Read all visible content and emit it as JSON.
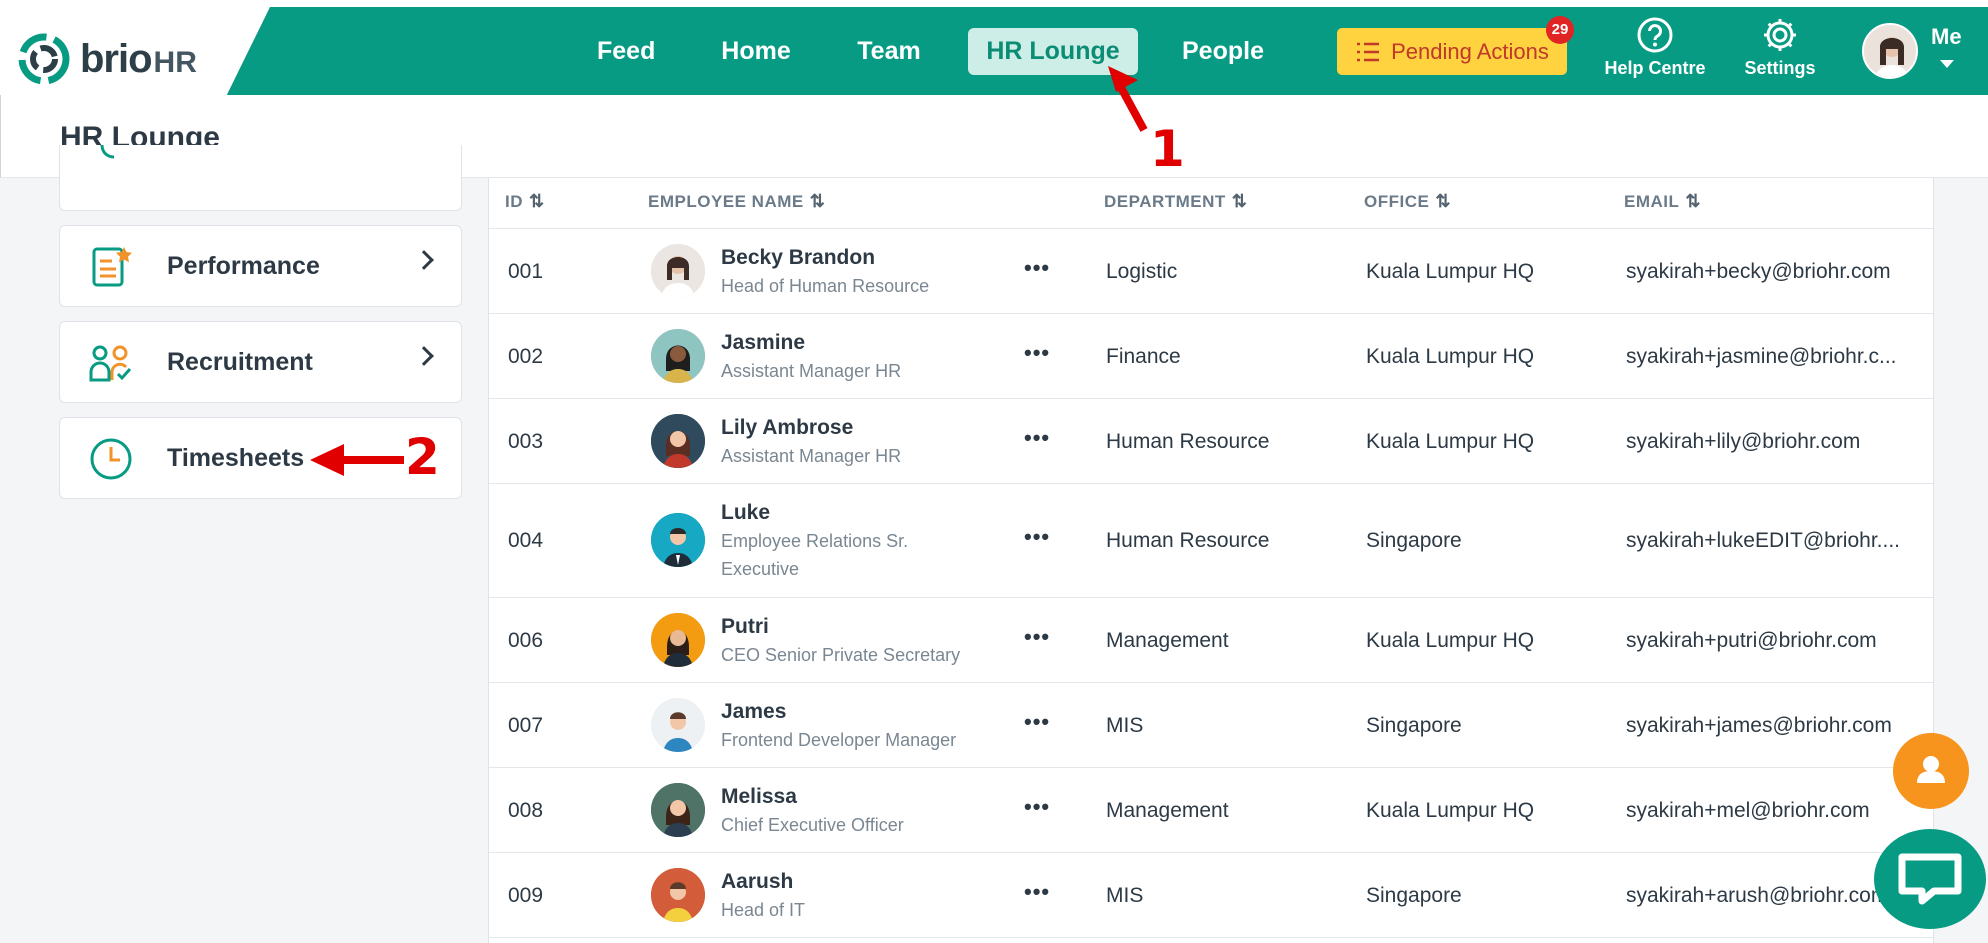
{
  "brand": {
    "name": "brio",
    "suffix": "HR"
  },
  "nav": {
    "items": [
      {
        "label": "Feed"
      },
      {
        "label": "Home"
      },
      {
        "label": "Team"
      },
      {
        "label": "HR Lounge",
        "active": true
      },
      {
        "label": "People"
      }
    ],
    "pending": {
      "label": "Pending Actions",
      "count": "29"
    },
    "help_label": "Help Centre",
    "settings_label": "Settings",
    "me_label": "Me"
  },
  "page": {
    "title": "HR Lounge"
  },
  "sidebar": {
    "items": [
      {
        "label": "Performance",
        "icon": "performance-icon"
      },
      {
        "label": "Recruitment",
        "icon": "recruitment-icon"
      },
      {
        "label": "Timesheets",
        "icon": "clock-icon"
      }
    ]
  },
  "table": {
    "columns": [
      "ID",
      "EMPLOYEE NAME",
      "DEPARTMENT",
      "OFFICE",
      "EMAIL"
    ],
    "rows": [
      {
        "id": "001",
        "name": "Becky Brandon",
        "title": "Head of Human Resource",
        "department": "Logistic",
        "office": "Kuala Lumpur HQ",
        "email": "syakirah+becky@briohr.com"
      },
      {
        "id": "002",
        "name": "Jasmine",
        "title": "Assistant Manager HR",
        "department": "Finance",
        "office": "Kuala Lumpur HQ",
        "email": "syakirah+jasmine@briohr.c..."
      },
      {
        "id": "003",
        "name": "Lily Ambrose",
        "title": "Assistant Manager HR",
        "department": "Human Resource",
        "office": "Kuala Lumpur HQ",
        "email": "syakirah+lily@briohr.com"
      },
      {
        "id": "004",
        "name": "Luke",
        "title": "Employee Relations Sr. Executive",
        "department": "Human Resource",
        "office": "Singapore",
        "email": "syakirah+lukeEDIT@briohr...."
      },
      {
        "id": "006",
        "name": "Putri",
        "title": "CEO Senior Private Secretary",
        "department": "Management",
        "office": "Kuala Lumpur HQ",
        "email": "syakirah+putri@briohr.com"
      },
      {
        "id": "007",
        "name": "James",
        "title": "Frontend Developer Manager",
        "department": "MIS",
        "office": "Singapore",
        "email": "syakirah+james@briohr.com"
      },
      {
        "id": "008",
        "name": "Melissa",
        "title": "Chief Executive Officer",
        "department": "Management",
        "office": "Kuala Lumpur HQ",
        "email": "syakirah+mel@briohr.com"
      },
      {
        "id": "009",
        "name": "Aarush",
        "title": "Head of IT",
        "department": "MIS",
        "office": "Singapore",
        "email": "syakirah+arush@briohr.com"
      }
    ]
  },
  "annotations": {
    "step1": "1",
    "step2": "2"
  },
  "colors": {
    "brand": "#069b82",
    "pending_bg": "#ffd23f",
    "annotation": "#e00000",
    "fab_user": "#f7941d"
  }
}
